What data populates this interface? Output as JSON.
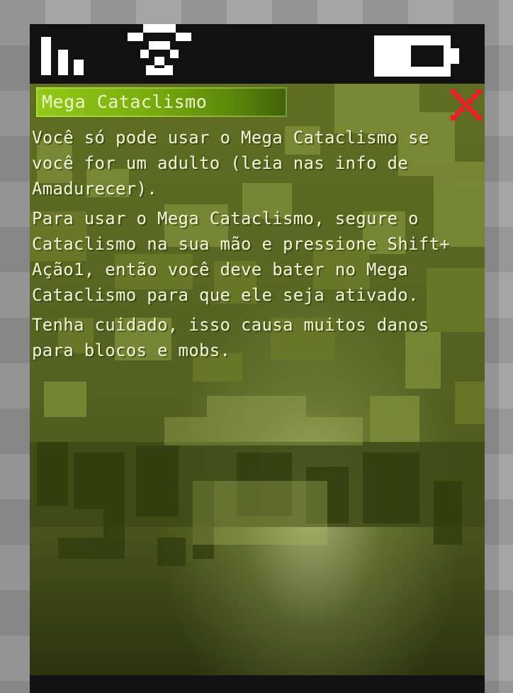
{
  "statusbar": {
    "signal_icon": "signal-bars-icon",
    "wifi_icon": "wifi-icon",
    "battery_icon": "battery-icon"
  },
  "dialog": {
    "title": "Mega Cataclismo",
    "close_icon": "close-x-icon",
    "paragraphs": [
      "Você só pode usar o Mega Cataclismo se você for um adulto (leia nas info de Amadurecer).",
      "Para usar o Mega Cataclismo, segure o Cataclismo na sua mão e pressione Shift+ Ação1, então você deve bater no Mega Cataclismo para que ele seja ativado.",
      "Tenha cuidado, isso causa muitos danos para blocos e mobs."
    ]
  },
  "colors": {
    "title_bar": "#7db010",
    "close_x": "#e8202a",
    "text": "#f1f4d6",
    "background": "#566422"
  }
}
